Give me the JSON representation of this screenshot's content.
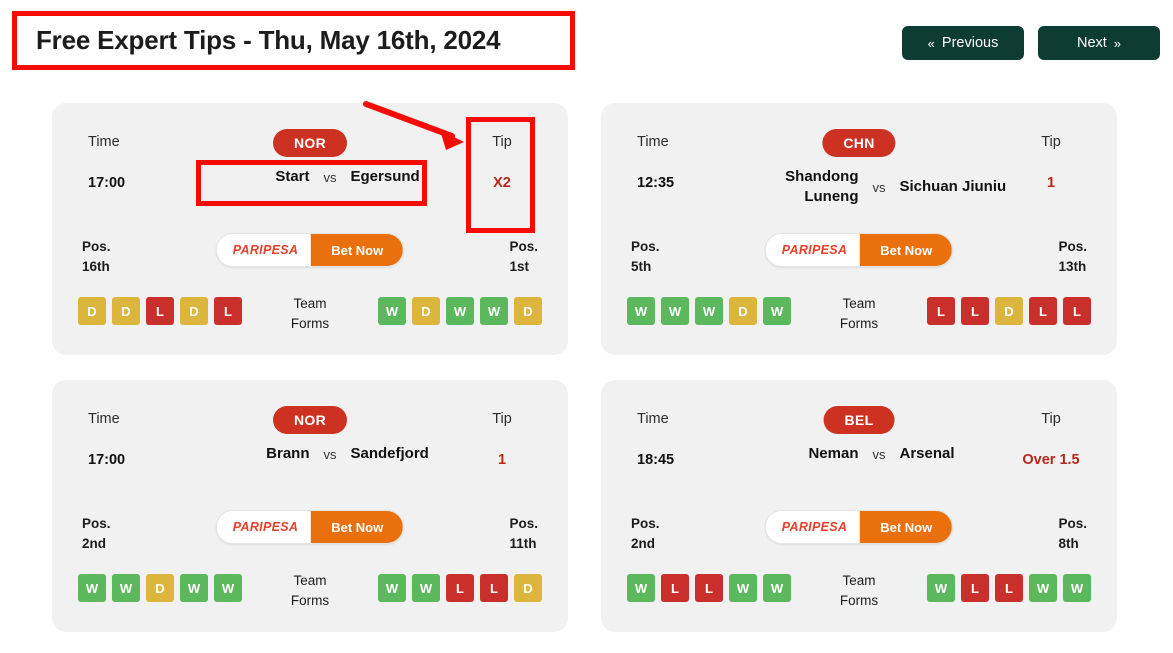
{
  "header": {
    "title": "Free Expert Tips - Thu, May 16th, 2024",
    "prev_label": "Previous",
    "next_label": "Next",
    "prev_chevron": "«",
    "next_chevron": "»",
    "accent_red": "#f60c05",
    "button_green": "#0d3d32"
  },
  "labels": {
    "time": "Time",
    "tip": "Tip",
    "vs": "vs",
    "pos": "Pos.",
    "team_forms_line1": "Team",
    "team_forms_line2": "Forms",
    "bet_brand": "PARIPESA",
    "bet_cta": "Bet Now"
  },
  "colors": {
    "league_badge": "#cd3122",
    "tip_text": "#b4291b",
    "form_win": "#5cb85c",
    "form_draw": "#dcb63c",
    "form_loss": "#c9302c",
    "bet_orange": "#e9700d",
    "card_bg": "#f1f1f1"
  },
  "matches": [
    {
      "league": "NOR",
      "time": "17:00",
      "home": "Start",
      "away": "Egersund",
      "tip": "X2",
      "home_pos": "16th",
      "away_pos": "1st",
      "home_form": [
        "D",
        "D",
        "L",
        "D",
        "L"
      ],
      "away_form": [
        "W",
        "D",
        "W",
        "W",
        "D"
      ]
    },
    {
      "league": "CHN",
      "time": "12:35",
      "home": "Shandong Luneng",
      "away": "Sichuan Jiuniu",
      "tip": "1",
      "home_pos": "5th",
      "away_pos": "13th",
      "home_form": [
        "W",
        "W",
        "W",
        "D",
        "W"
      ],
      "away_form": [
        "L",
        "L",
        "D",
        "L",
        "L"
      ]
    },
    {
      "league": "NOR",
      "time": "17:00",
      "home": "Brann",
      "away": "Sandefjord",
      "tip": "1",
      "home_pos": "2nd",
      "away_pos": "11th",
      "home_form": [
        "W",
        "W",
        "D",
        "W",
        "W"
      ],
      "away_form": [
        "W",
        "W",
        "L",
        "L",
        "D"
      ]
    },
    {
      "league": "BEL",
      "time": "18:45",
      "home": "Neman",
      "away": "Arsenal",
      "tip": "Over 1.5",
      "home_pos": "2nd",
      "away_pos": "8th",
      "home_form": [
        "W",
        "L",
        "L",
        "W",
        "W"
      ],
      "away_form": [
        "W",
        "L",
        "L",
        "W",
        "W"
      ]
    }
  ]
}
